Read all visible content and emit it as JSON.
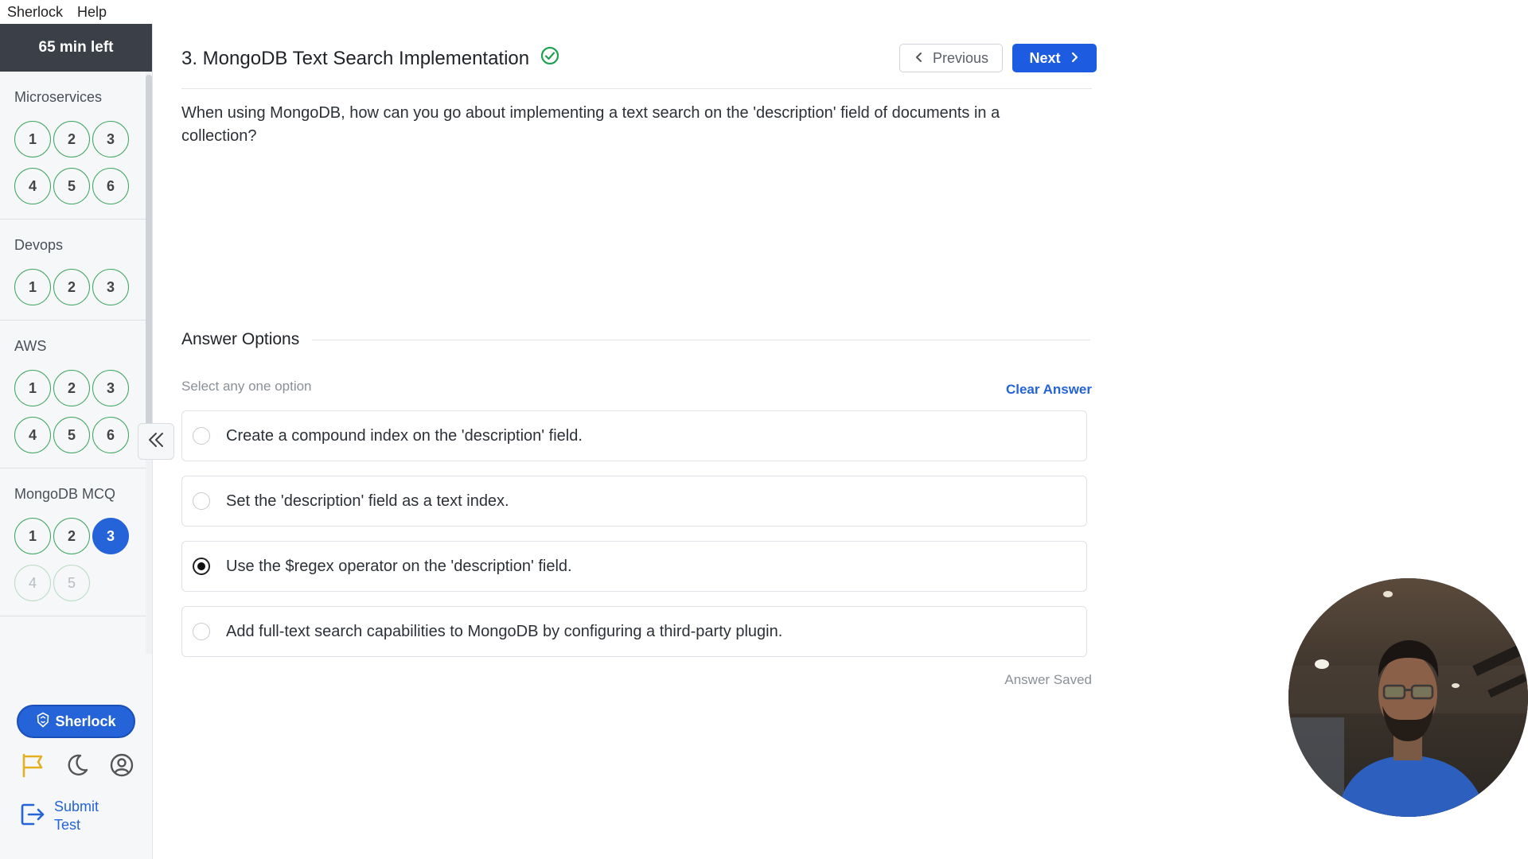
{
  "menubar": {
    "items": [
      "Sherlock",
      "Help"
    ]
  },
  "sidebar": {
    "timer": "65 min left",
    "sections": [
      {
        "title": "Microservices",
        "questions": [
          {
            "n": "1",
            "state": "answered"
          },
          {
            "n": "2",
            "state": "answered"
          },
          {
            "n": "3",
            "state": "answered"
          },
          {
            "n": "4",
            "state": "answered"
          },
          {
            "n": "5",
            "state": "answered"
          },
          {
            "n": "6",
            "state": "answered"
          }
        ]
      },
      {
        "title": "Devops",
        "questions": [
          {
            "n": "1",
            "state": "answered"
          },
          {
            "n": "2",
            "state": "answered"
          },
          {
            "n": "3",
            "state": "answered"
          }
        ]
      },
      {
        "title": "AWS",
        "questions": [
          {
            "n": "1",
            "state": "answered"
          },
          {
            "n": "2",
            "state": "answered"
          },
          {
            "n": "3",
            "state": "answered"
          },
          {
            "n": "4",
            "state": "answered"
          },
          {
            "n": "5",
            "state": "answered"
          },
          {
            "n": "6",
            "state": "answered"
          }
        ]
      },
      {
        "title": "MongoDB MCQ",
        "questions": [
          {
            "n": "1",
            "state": "answered"
          },
          {
            "n": "2",
            "state": "answered"
          },
          {
            "n": "3",
            "state": "current"
          },
          {
            "n": "4",
            "state": "unvisited"
          },
          {
            "n": "5",
            "state": "unvisited"
          }
        ]
      }
    ],
    "sherlock_button": "Sherlock",
    "submit_label_line1": "Submit",
    "submit_label_line2": "Test",
    "icons": [
      "flag-icon",
      "moon-icon",
      "user-circle-icon",
      "logout-icon"
    ]
  },
  "header": {
    "title": "3. MongoDB Text Search Implementation",
    "prev_label": "Previous",
    "next_label": "Next"
  },
  "question": {
    "text": "When using MongoDB, how can you go about implementing a text search on the 'description' field of documents in a collection?"
  },
  "answers": {
    "heading": "Answer Options",
    "hint": "Select any one option",
    "clear_label": "Clear Answer",
    "options": [
      {
        "text": "Create a compound index on the 'description' field.",
        "selected": false
      },
      {
        "text": "Set the 'description' field as a text index.",
        "selected": false
      },
      {
        "text": "Use the $regex operator on the 'description' field.",
        "selected": true
      },
      {
        "text": "Add full-text search capabilities to MongoDB by configuring a third-party plugin.",
        "selected": false
      }
    ],
    "status": "Answer Saved"
  },
  "colors": {
    "accent": "#2563d9",
    "answered_border": "#3fa560",
    "flag": "#e3b020"
  }
}
